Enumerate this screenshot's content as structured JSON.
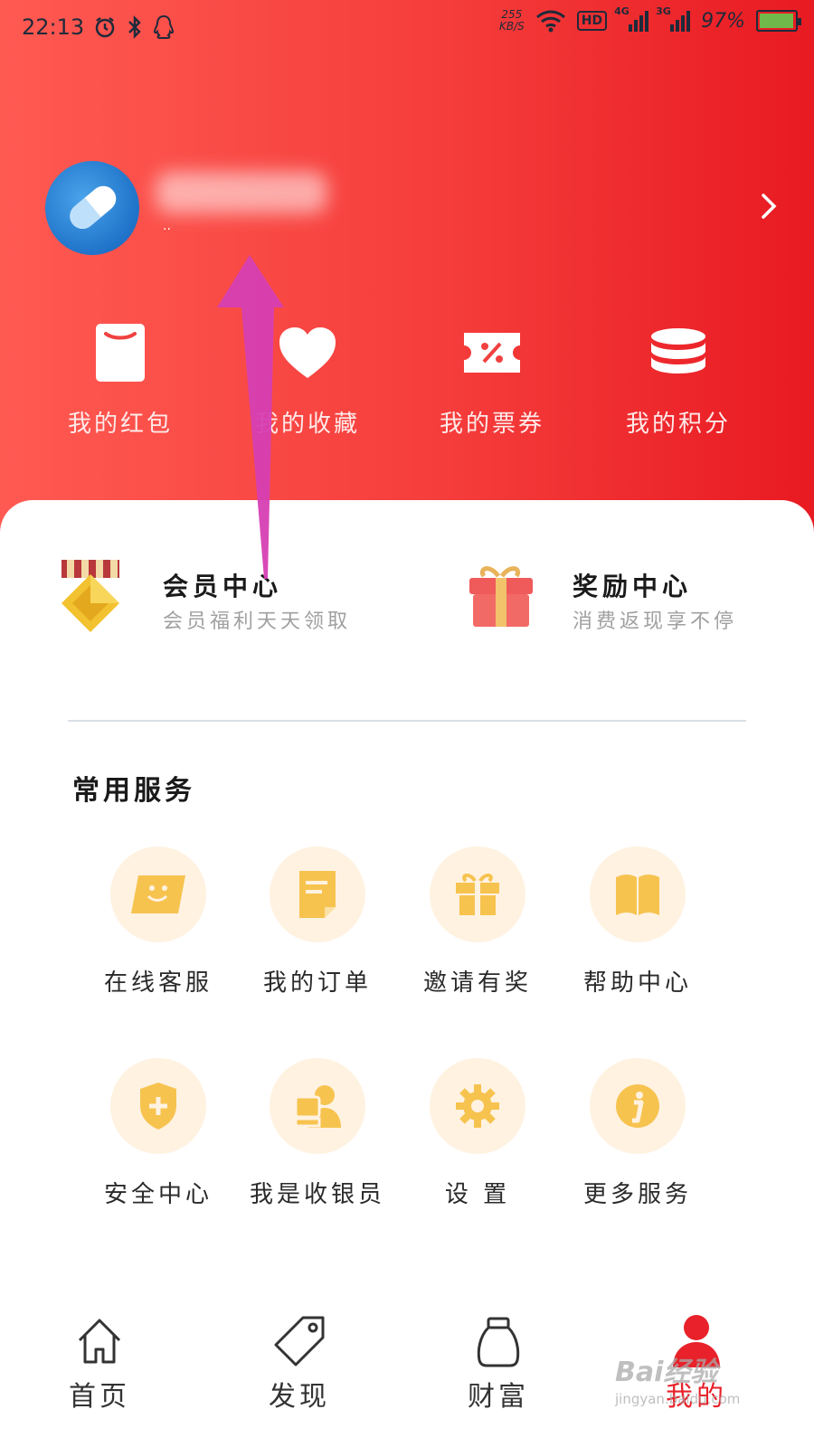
{
  "status_bar": {
    "time": "22:13",
    "net_speed_value": "255",
    "net_speed_unit": "KB/S",
    "hd_label": "HD",
    "signal_1_tag": "4G",
    "signal_2_tag": "3G",
    "battery_text": "97%",
    "battery_level": 0.97,
    "icons": [
      "alarm-icon",
      "bluetooth-icon",
      "qq-icon",
      "wifi-icon"
    ]
  },
  "profile": {
    "username_sub": ".."
  },
  "quick_actions": [
    {
      "label": "我的红包",
      "icon": "red-envelope-icon"
    },
    {
      "label": "我的收藏",
      "icon": "heart-icon"
    },
    {
      "label": "我的票券",
      "icon": "coupon-icon"
    },
    {
      "label": "我的积分",
      "icon": "coins-icon"
    }
  ],
  "promos": {
    "member": {
      "title": "会员中心",
      "subtitle": "会员福利天天领取",
      "icon": "medal-icon"
    },
    "reward": {
      "title": "奖励中心",
      "subtitle": "消费返现享不停",
      "icon": "gift-box-icon"
    }
  },
  "services": {
    "title": "常用服务",
    "items": [
      {
        "label": "在线客服",
        "icon": "chat-icon"
      },
      {
        "label": "我的订单",
        "icon": "order-icon"
      },
      {
        "label": "邀请有奖",
        "icon": "gift-icon"
      },
      {
        "label": "帮助中心",
        "icon": "book-icon"
      },
      {
        "label": "安全中心",
        "icon": "shield-icon"
      },
      {
        "label": "我是收银员",
        "icon": "cashier-icon"
      },
      {
        "label": "设 置",
        "icon": "gear-icon"
      },
      {
        "label": "更多服务",
        "icon": "info-icon"
      }
    ]
  },
  "bottom_nav": [
    {
      "label": "首页",
      "icon": "home-icon"
    },
    {
      "label": "发现",
      "icon": "tag-icon"
    },
    {
      "label": "财富",
      "icon": "money-bag-icon"
    },
    {
      "label": "我的",
      "icon": "user-icon",
      "active": true
    }
  ],
  "watermark": {
    "main": "Bai经验",
    "sub": "jingyan.baidu.com"
  },
  "colors": {
    "header_start": "#ff5a52",
    "header_end": "#e81a22",
    "service_circle": "#fff2e1",
    "service_icon": "#f7c34f",
    "active_nav": "#e8212a",
    "annotation_arrow": "#d63fb3"
  }
}
